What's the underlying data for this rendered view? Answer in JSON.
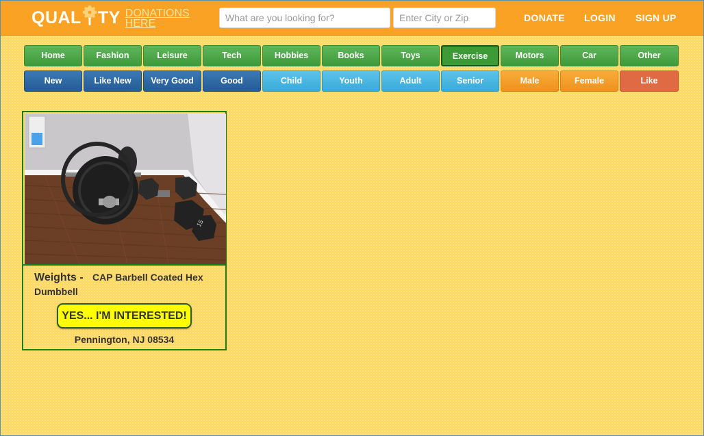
{
  "header": {
    "logo_main_left": "QUAL",
    "logo_main_right": "TY",
    "logo_sub_line1": "DONATIONS",
    "logo_sub_line2": "HERE",
    "search_placeholder": "What are you looking for?",
    "location_placeholder": "Enter City or Zip",
    "nav": {
      "donate": "DONATE",
      "login": "LOGIN",
      "signup": "SIGN UP"
    }
  },
  "categories": [
    "Home",
    "Fashion",
    "Leisure",
    "Tech",
    "Hobbies",
    "Books",
    "Toys",
    "Exercise",
    "Motors",
    "Car",
    "Other"
  ],
  "active_category": "Exercise",
  "filters": [
    "New",
    "Like New",
    "Very Good",
    "Good",
    "Child",
    "Youth",
    "Adult",
    "Senior",
    "Male",
    "Female",
    "Like"
  ],
  "colors": {
    "header": "#f9a223",
    "background": "#ffd965",
    "card_border": "#15801b",
    "interest_button": "#ffff00"
  },
  "listing": {
    "category": "Weights -",
    "name": "CAP Barbell Coated Hex Dumbbell",
    "button": "YES... I'M INTERESTED!",
    "location": "Pennington, NJ 08534",
    "plate_label": "15"
  }
}
